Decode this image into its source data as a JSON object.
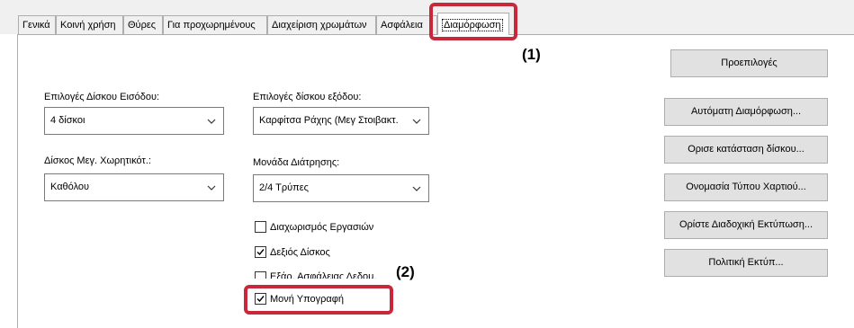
{
  "tabs": [
    {
      "label": "Γενικά"
    },
    {
      "label": "Κοινή χρήση"
    },
    {
      "label": "Θύρες"
    },
    {
      "label": "Για προχωρημένους"
    },
    {
      "label": "Διαχείριση χρωμάτων"
    },
    {
      "label": "Ασφάλεια"
    },
    {
      "label": "Διαμόρφωση",
      "active": true
    }
  ],
  "markers": {
    "m1": "(1)",
    "m2": "(2)"
  },
  "buttons": {
    "defaults": "Προεπιλογές",
    "auto_config": "Αυτόματη Διαμόρφωση...",
    "set_tray_status": "Ορισε κατάσταση δίσκου...",
    "paper_type_name": "Ονομασία Τύπου Χαρτιού...",
    "set_sequential_print": "Ορίστε Διαδοχική Εκτύπωση...",
    "print_policy": "Πολιτική Εκτύπ..."
  },
  "fields": {
    "input_tray_options": {
      "label": "Επιλογές Δίσκου Εισόδου:",
      "value": "4 δίσκοι"
    },
    "output_tray_options": {
      "label": "Επιλογές δίσκου εξόδου:",
      "value": "Καρφίτσα Ράχης (Μεγ Στοιβακτ."
    },
    "large_capacity_tray": {
      "label": "Δίσκος Μεγ. Χωρητικότ.:",
      "value": "Καθόλου"
    },
    "punch_unit": {
      "label": "Μονάδα Διάτρησης:",
      "value": "2/4 Τρύπες"
    }
  },
  "checkboxes": [
    {
      "label": "Διαχωρισμός Εργασιών",
      "checked": false
    },
    {
      "label": "Δεξιός Δίσκος",
      "checked": true
    },
    {
      "label": "Εξάρ. Ασφάλειας Δεδομ.",
      "checked": false
    },
    {
      "label": "Μονή Υπογραφή",
      "checked": true
    }
  ],
  "colors": {
    "highlight": "#c8283a",
    "button_face": "#e1e1e1",
    "border": "#adadad"
  }
}
